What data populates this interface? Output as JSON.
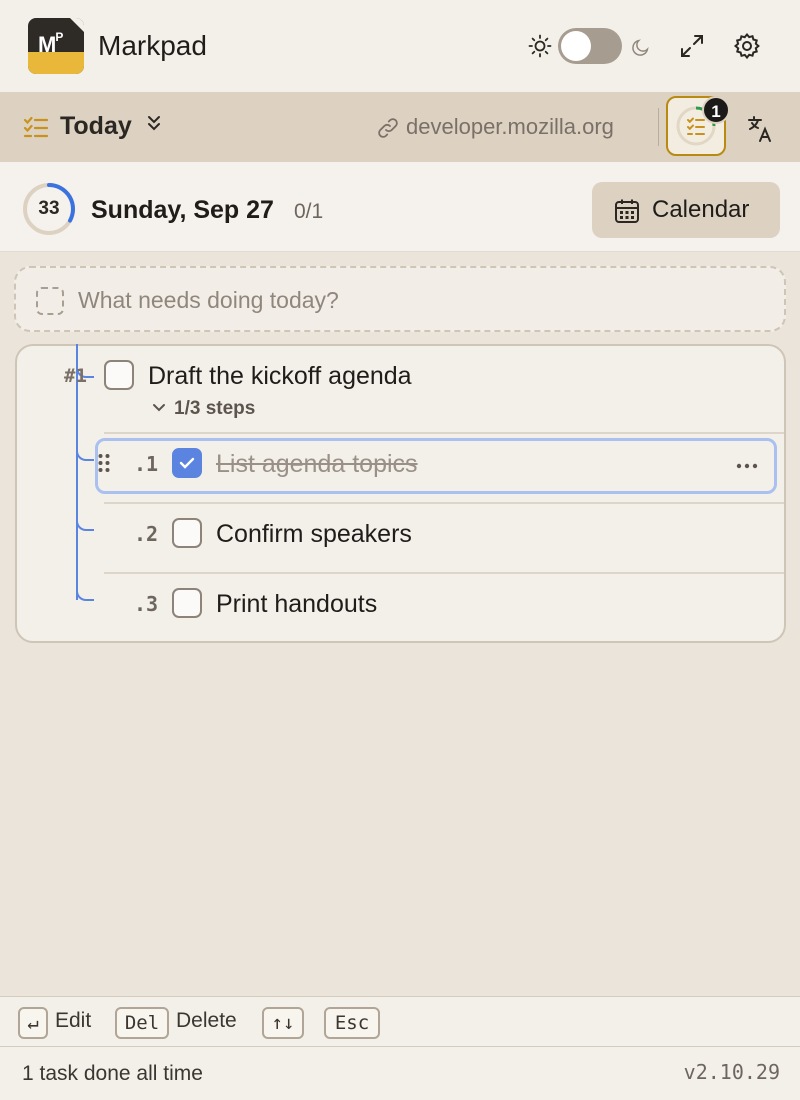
{
  "app": {
    "title": "Markpad",
    "logo_text": "MP"
  },
  "header": {
    "theme_toggle": {
      "state": "light",
      "icons": [
        "sun-icon",
        "moon-icon"
      ]
    },
    "icons": [
      "expand-icon",
      "gear-icon"
    ]
  },
  "toolbar": {
    "view_label": "Today",
    "domain": "developer.mozilla.org",
    "badge_count": "1"
  },
  "datebar": {
    "ring_value": "33",
    "ring_progress": 0.33,
    "date": "Sunday, Sep 27",
    "count": "0/1",
    "calendar_label": "Calendar"
  },
  "new_task": {
    "placeholder": "What needs doing today?"
  },
  "tasks": [
    {
      "number": "#1",
      "title": "Draft the kickoff agenda",
      "steps_summary": "1/3 steps",
      "done": false,
      "steps": [
        {
          "number": ".1",
          "title": "List agenda topics",
          "done": true,
          "selected": true
        },
        {
          "number": ".2",
          "title": "Confirm speakers",
          "done": false
        },
        {
          "number": ".3",
          "title": "Print handouts",
          "done": false
        }
      ]
    }
  ],
  "shortcuts": [
    {
      "key": "↵",
      "label": "Edit"
    },
    {
      "key": "Del",
      "label": "Delete"
    },
    {
      "key": "↑↓",
      "label": ""
    },
    {
      "key": "Esc",
      "label": ""
    }
  ],
  "status": {
    "text": "1 task done all time",
    "version": "v2.10.29"
  },
  "colors": {
    "accent": "#5b84e0",
    "brand_yellow": "#e9b83a",
    "progress_green": "#2e9a4a"
  }
}
